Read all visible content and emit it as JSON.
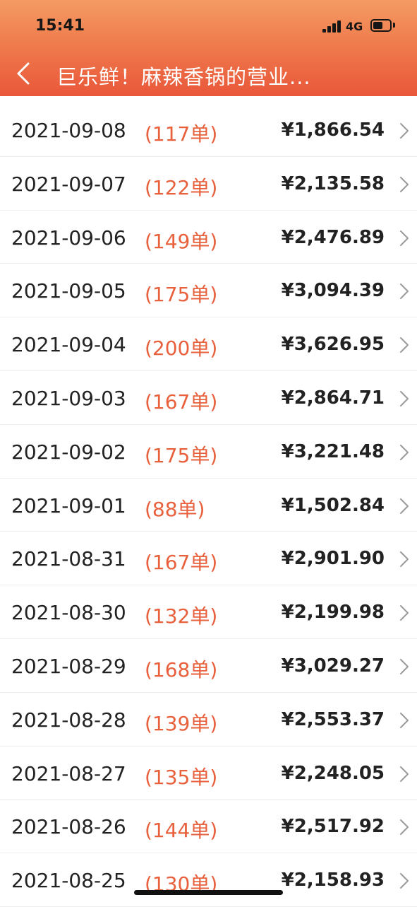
{
  "status_bar": {
    "time": "15:41",
    "network": "4G"
  },
  "nav": {
    "title": "巨乐鲜！麻辣香锅的营业..."
  },
  "colors": {
    "header_gradient_top": "#f49b63",
    "header_gradient_bottom": "#e9573a",
    "order_count": "#e8603c",
    "text": "#222222"
  },
  "rows": [
    {
      "date": "2021-09-08",
      "count": "(117单)",
      "amount": "¥1,866.54"
    },
    {
      "date": "2021-09-07",
      "count": "(122单)",
      "amount": "¥2,135.58"
    },
    {
      "date": "2021-09-06",
      "count": "(149单)",
      "amount": "¥2,476.89"
    },
    {
      "date": "2021-09-05",
      "count": "(175单)",
      "amount": "¥3,094.39"
    },
    {
      "date": "2021-09-04",
      "count": "(200单)",
      "amount": "¥3,626.95"
    },
    {
      "date": "2021-09-03",
      "count": "(167单)",
      "amount": "¥2,864.71"
    },
    {
      "date": "2021-09-02",
      "count": "(175单)",
      "amount": "¥3,221.48"
    },
    {
      "date": "2021-09-01",
      "count": "(88单)",
      "amount": "¥1,502.84"
    },
    {
      "date": "2021-08-31",
      "count": "(167单)",
      "amount": "¥2,901.90"
    },
    {
      "date": "2021-08-30",
      "count": "(132单)",
      "amount": "¥2,199.98"
    },
    {
      "date": "2021-08-29",
      "count": "(168单)",
      "amount": "¥3,029.27"
    },
    {
      "date": "2021-08-28",
      "count": "(139单)",
      "amount": "¥2,553.37"
    },
    {
      "date": "2021-08-27",
      "count": "(135单)",
      "amount": "¥2,248.05"
    },
    {
      "date": "2021-08-26",
      "count": "(144单)",
      "amount": "¥2,517.92"
    },
    {
      "date": "2021-08-25",
      "count": "(130单)",
      "amount": "¥2,158.93"
    }
  ]
}
